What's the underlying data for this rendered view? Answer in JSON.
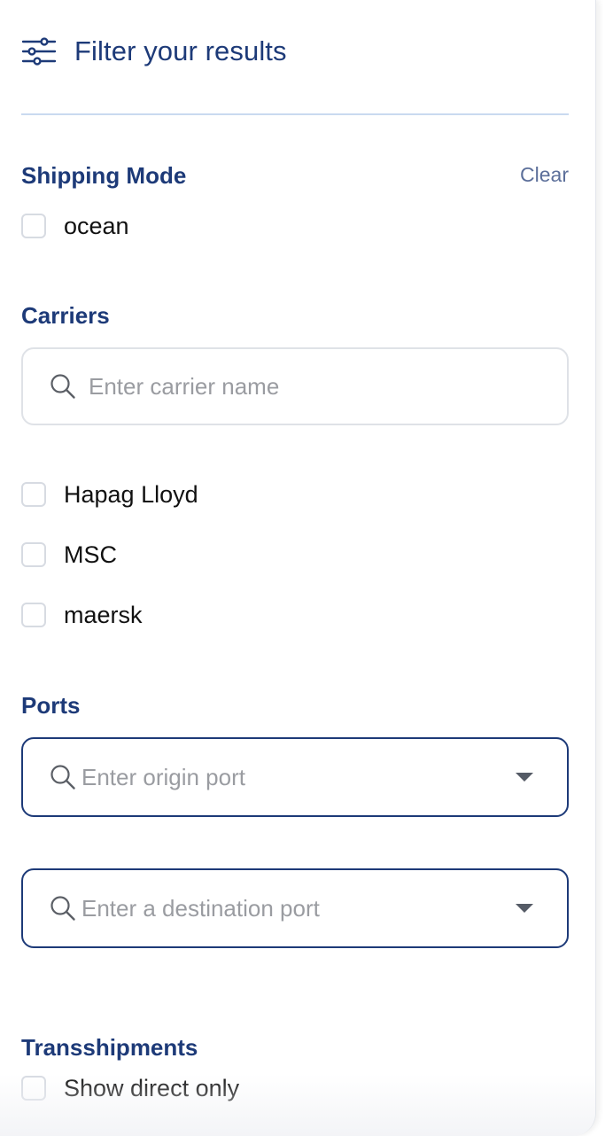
{
  "header": {
    "title": "Filter your results",
    "icon": "sliders-icon"
  },
  "shipping_mode": {
    "title": "Shipping Mode",
    "clear_label": "Clear",
    "options": [
      {
        "label": "ocean",
        "checked": false
      }
    ]
  },
  "carriers": {
    "title": "Carriers",
    "search_placeholder": "Enter carrier name",
    "search_value": "",
    "options": [
      {
        "label": "Hapag Lloyd",
        "checked": false
      },
      {
        "label": "MSC",
        "checked": false
      },
      {
        "label": "maersk",
        "checked": false
      }
    ]
  },
  "ports": {
    "title": "Ports",
    "origin_placeholder": "Enter origin port",
    "destination_placeholder": "Enter a destination port"
  },
  "transshipments": {
    "title": "Transshipments",
    "options": [
      {
        "label": "Show direct only",
        "checked": false
      }
    ]
  },
  "colors": {
    "primary": "#1d3a78",
    "divider": "#c9daf0",
    "muted_link": "#5c6f9a",
    "placeholder": "#9a9ca1",
    "checkbox_border": "#d7dbe2"
  }
}
